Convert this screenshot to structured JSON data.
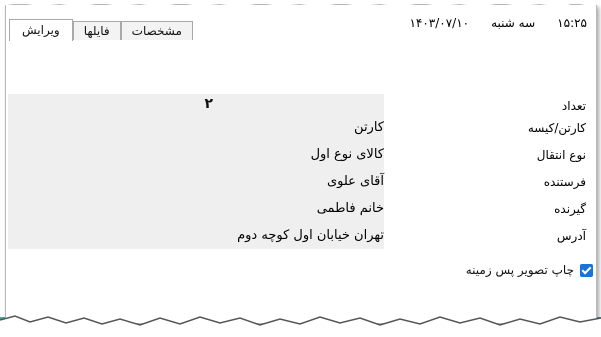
{
  "header": {
    "time": "۱۵:۲۵",
    "weekday": "سه شنبه",
    "date": "۱۴۰۳/۰۷/۱۰"
  },
  "tabs": [
    {
      "label": "ویرایش",
      "active": true
    },
    {
      "label": "فایلها",
      "active": false
    },
    {
      "label": "مشخصات",
      "active": false
    }
  ],
  "fields": {
    "count": {
      "label": "تعداد",
      "value": "۲"
    },
    "package": {
      "label": "کارتن/کیسه",
      "value": "کارتن"
    },
    "transport": {
      "label": "نوع انتقال",
      "value": "کالای نوع اول"
    },
    "sender": {
      "label": "فرستنده",
      "value": "آقای علوی"
    },
    "receiver": {
      "label": "گیرنده",
      "value": "خانم فاطمی"
    },
    "address": {
      "label": "آدرس",
      "value": "تهران خیابان اول کوچه دوم"
    }
  },
  "print_background": {
    "label": "چاپ تصویر پس زمینه",
    "checked": true
  },
  "colors": {
    "accent": "#1a73d9",
    "field_bg": "#efefef",
    "strip": "#4aa59b"
  }
}
